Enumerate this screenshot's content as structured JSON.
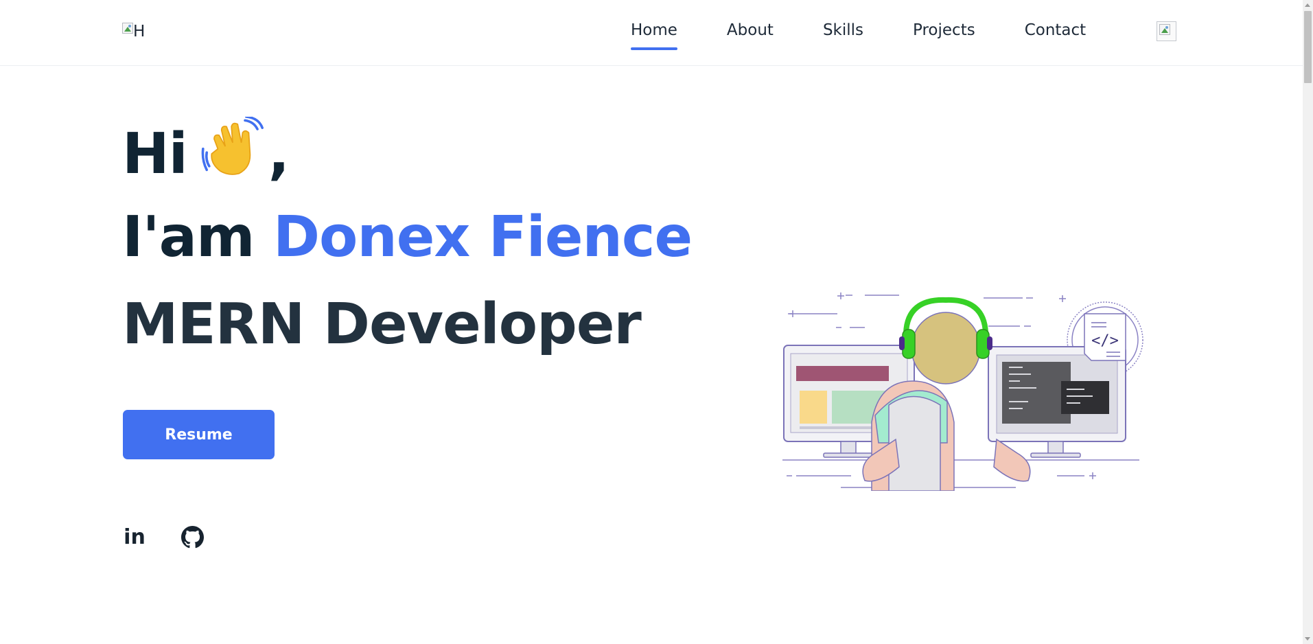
{
  "header": {
    "logo_alt": "H",
    "nav": [
      {
        "label": "Home",
        "active": true
      },
      {
        "label": "About",
        "active": false
      },
      {
        "label": "Skills",
        "active": false
      },
      {
        "label": "Projects",
        "active": false
      },
      {
        "label": "Contact",
        "active": false
      }
    ]
  },
  "hero": {
    "greeting": "Hi",
    "greeting_comma": ",",
    "intro_prefix": "I'am ",
    "name": "Donex Fience",
    "role": "MERN Developer",
    "resume_label": "Resume"
  },
  "social": [
    {
      "name": "linkedin",
      "label": "in"
    },
    {
      "name": "github",
      "icon": "github-icon"
    }
  ],
  "illustration": {
    "code_tag": "</>"
  },
  "colors": {
    "accent": "#4170f0",
    "heading": "#102433",
    "text": "#1e2a38"
  }
}
